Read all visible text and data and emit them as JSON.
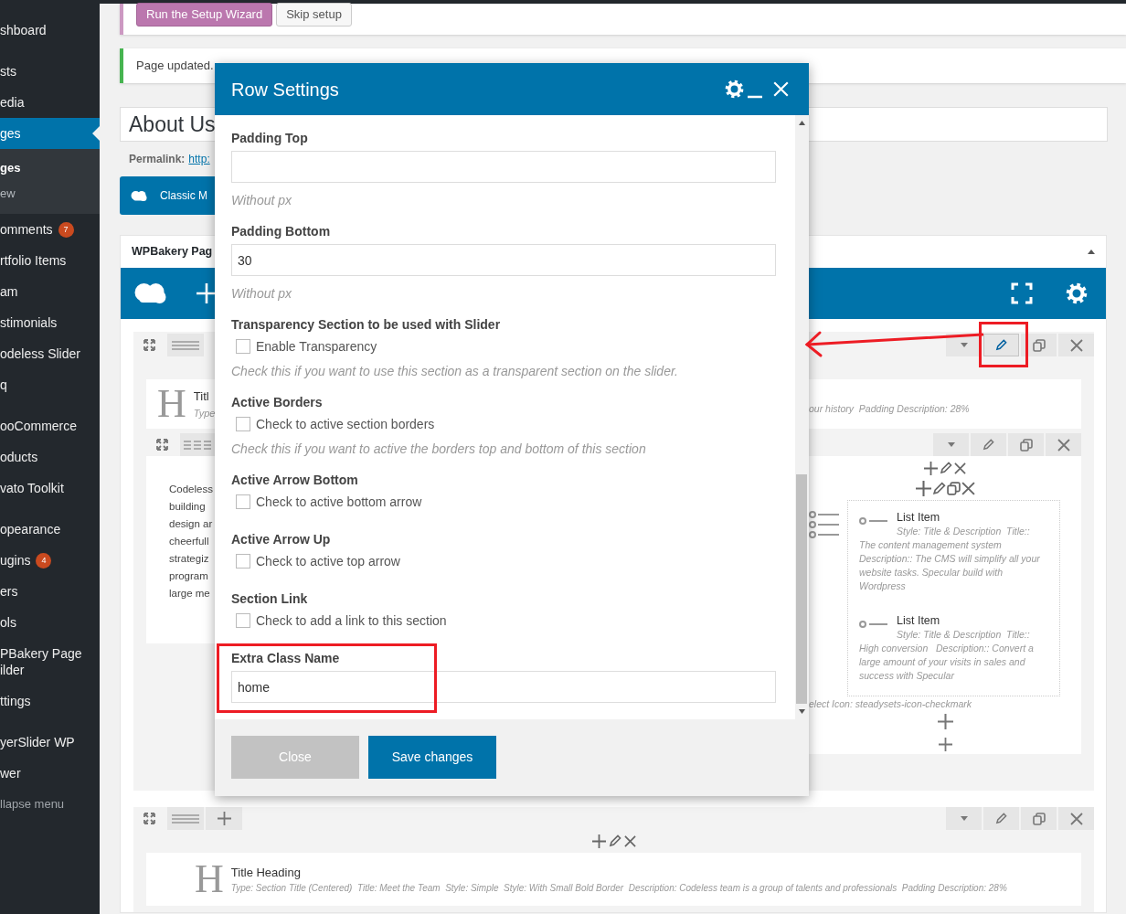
{
  "sidebar": {
    "groups": [
      [
        {
          "kind": "link",
          "label": "shboard",
          "selected": false
        }
      ],
      [
        {
          "kind": "link",
          "label": "sts",
          "selected": false
        },
        {
          "kind": "link",
          "label": "edia",
          "selected": false
        },
        {
          "kind": "link",
          "label": "ges",
          "selected": true,
          "children": [
            {
              "label": "ges",
              "selected": true
            },
            {
              "label": "ew",
              "selected": false
            }
          ]
        },
        {
          "kind": "link",
          "label": "omments",
          "badge": "7",
          "selected": false
        },
        {
          "kind": "link",
          "label": "rtfolio Items",
          "selected": false
        },
        {
          "kind": "link",
          "label": "am",
          "selected": false
        },
        {
          "kind": "link",
          "label": "stimonials",
          "selected": false
        },
        {
          "kind": "link",
          "label": "odeless Slider",
          "selected": false
        },
        {
          "kind": "link",
          "label": "q",
          "selected": false
        }
      ],
      [
        {
          "kind": "link",
          "label": "ooCommerce",
          "selected": false
        },
        {
          "kind": "link",
          "label": "oducts",
          "selected": false
        },
        {
          "kind": "link",
          "label": "vato Toolkit",
          "selected": false
        }
      ],
      [
        {
          "kind": "link",
          "label": "opearance",
          "selected": false
        },
        {
          "kind": "link",
          "label": "ugins",
          "badge": "4",
          "selected": false
        },
        {
          "kind": "link",
          "label": "ers",
          "selected": false
        },
        {
          "kind": "link",
          "label": "ols",
          "selected": false
        },
        {
          "kind": "link",
          "label": "PBakery Page ilder",
          "selected": false
        },
        {
          "kind": "link",
          "label": "ttings",
          "selected": false
        }
      ],
      [
        {
          "kind": "link",
          "label": "yerSlider WP",
          "selected": false
        },
        {
          "kind": "link",
          "label": "wer",
          "selected": false
        },
        {
          "kind": "collapse",
          "label": "llapse menu",
          "selected": false
        }
      ]
    ]
  },
  "setup_notice": {
    "buttons": [
      {
        "label": "Run the Setup Wizard",
        "kind": "primary"
      },
      {
        "label": "Skip setup",
        "kind": "secondary"
      }
    ]
  },
  "update_notice": {
    "text": "Page updated."
  },
  "page_title": {
    "value": "About Us"
  },
  "permalink": {
    "label": "Permalink:",
    "link": "http:"
  },
  "classic_mode_button": {
    "label": "Classic M"
  },
  "builder": {
    "title": "WPBakery Pag",
    "rows": [
      {
        "edit_highlighted": true,
        "title_element": {
          "icon": "H",
          "title": "Titl",
          "description_left": "Type",
          "description_right": "our history  Padding Description: 28%"
        },
        "inner_row": {
          "left_column": [
            "Codeless",
            "building",
            "design ar",
            "cheerfull",
            "strategiz",
            "program",
            "large me"
          ],
          "list_items": [
            {
              "title": "List Item",
              "description": "Style: Title & Description  Title:: The content management system  Description:: The CMS will simplify all your website tasks. Specular build with Wordpress"
            },
            {
              "title": "List Item",
              "description": "Style: Title & Description  Title:: High conversion   Description:: Convert a large amount of your visits in sales and success with Specular"
            }
          ],
          "icon_note": "elect Icon: steadysets-icon-checkmark"
        }
      },
      {
        "edit_highlighted": false,
        "title_element": {
          "icon": "H",
          "title": "Title Heading",
          "description": "Type: Section Title (Centered)  Title: Meet the Team  Style: Simple  Style: With Small Bold Border  Description: Codeless team is a group of talents and professionals  Padding Description: 28%"
        }
      }
    ]
  },
  "modal": {
    "title": "Row Settings",
    "fields": [
      {
        "kind": "text",
        "label": "Padding Top",
        "hint": "Without px"
      },
      {
        "kind": "text",
        "label": "Padding Bottom",
        "value": "30",
        "hint": "Without px"
      },
      {
        "kind": "checkbox",
        "label": "Transparency Section to be used with Slider",
        "option": "Enable Transparency",
        "checked": false,
        "hint": "Check this if you want to use this section as a transparent section on the slider."
      },
      {
        "kind": "checkbox",
        "label": "Active Borders",
        "option": "Check to active section borders",
        "checked": false,
        "hint": "Check this if you want to active the borders top and bottom of this section"
      },
      {
        "kind": "checkbox",
        "label": "Active Arrow Bottom",
        "option": "Check to active bottom arrow",
        "checked": false
      },
      {
        "kind": "checkbox",
        "label": "Active Arrow Up",
        "option": "Check to active top arrow",
        "checked": false
      },
      {
        "kind": "checkbox",
        "label": "Section Link",
        "option": "Check to add a link to this section",
        "checked": false
      },
      {
        "kind": "text",
        "label": "Extra Class Name",
        "value": "home"
      }
    ],
    "buttons": [
      {
        "label": "Close",
        "kind": "secondary"
      },
      {
        "label": "Save changes",
        "kind": "primary"
      }
    ]
  }
}
